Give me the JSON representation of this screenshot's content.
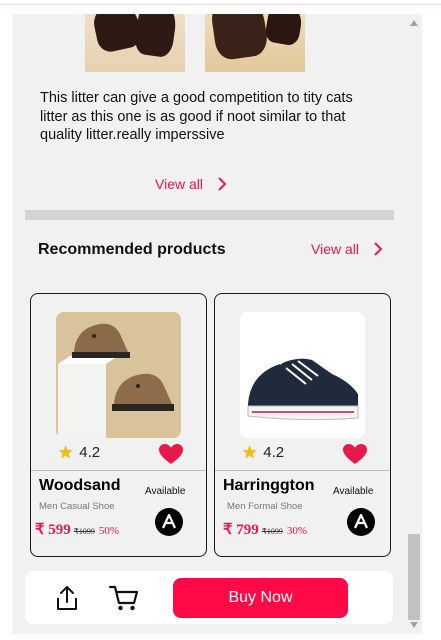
{
  "review": {
    "text": "This litter can give a good competition to tity cats litter as this one is as good if noot similar to that quality litter.really imperssive",
    "view_all_label": "View all"
  },
  "recommended": {
    "title": "Recommended products",
    "view_all_label": "View all",
    "products": [
      {
        "name": "Woodsand",
        "category": "Men Casual Shoe",
        "rating": "4.2",
        "availability": "Available",
        "price": "₹ 599",
        "mrp": "₹1099",
        "discount": "50%"
      },
      {
        "name": "Harringgton",
        "category": "Men Formal Shoe",
        "rating": "4.2",
        "availability": "Available",
        "price": "₹ 799",
        "mrp": "₹1099",
        "discount": "30%"
      }
    ]
  },
  "actions": {
    "buy_now_label": "Buy Now"
  },
  "colors": {
    "accent": "#e8194a",
    "buy_button": "#ff0a47",
    "panel_bg": "#f1f1f1"
  },
  "icons": [
    "chevron-right-icon",
    "star-icon",
    "heart-icon",
    "brand-logo-icon",
    "share-icon",
    "cart-icon"
  ]
}
